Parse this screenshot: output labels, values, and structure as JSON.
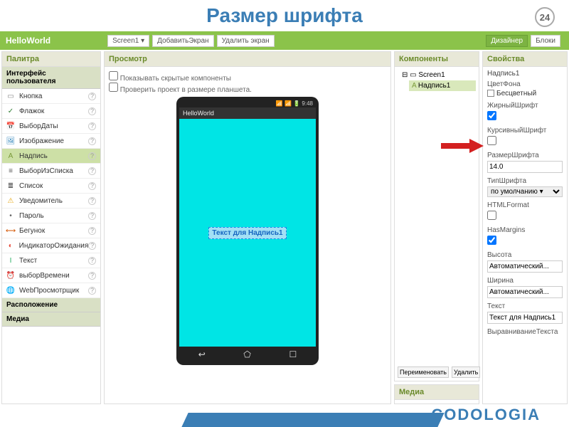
{
  "slide": {
    "title": "Размер шрифта",
    "number": "24"
  },
  "topbar": {
    "project": "HelloWorld",
    "screen_btn": "Screen1 ▾",
    "add_btn": "ДобавитьЭкран",
    "del_btn": "Удалить экран",
    "designer_btn": "Дизайнер",
    "blocks_btn": "Блоки"
  },
  "palette": {
    "title": "Палитра",
    "cat_ui": "Интерфейс пользователя",
    "items": [
      {
        "label": "Кнопка",
        "icon": "▭",
        "color": "#888"
      },
      {
        "label": "Флажок",
        "icon": "✓",
        "color": "#2e7d32"
      },
      {
        "label": "ВыборДаты",
        "icon": "📅",
        "color": "#c0392b"
      },
      {
        "label": "Изображение",
        "icon": "🖼",
        "color": "#2980b9"
      },
      {
        "label": "Надпись",
        "icon": "A",
        "color": "#7a9a3a",
        "sel": true
      },
      {
        "label": "ВыборИзСписка",
        "icon": "≡",
        "color": "#555"
      },
      {
        "label": "Список",
        "icon": "≣",
        "color": "#333"
      },
      {
        "label": "Уведомитель",
        "icon": "⚠",
        "color": "#e6a817"
      },
      {
        "label": "Пароль",
        "icon": "•",
        "color": "#666"
      },
      {
        "label": "Бегунок",
        "icon": "⟷",
        "color": "#d35400"
      },
      {
        "label": "ИндикаторОжидания",
        "icon": "◐",
        "color": "#e74c3c"
      },
      {
        "label": "Текст",
        "icon": "I",
        "color": "#27ae60"
      },
      {
        "label": "выборВремени",
        "icon": "⏰",
        "color": "#8e44ad"
      },
      {
        "label": "WebПросмотрщик",
        "icon": "🌐",
        "color": "#16a085"
      }
    ],
    "cat_layout": "Расположение",
    "cat_media": "Медиа"
  },
  "viewer": {
    "title": "Просмотр",
    "chk_hidden": "Показывать скрытые компоненты",
    "chk_tablet": "Проверить проект в размере планшета.",
    "phone_time": "9:48",
    "phone_app": "HelloWorld",
    "label_text": "Текст для Надпись1"
  },
  "components": {
    "title": "Компоненты",
    "root": "Screen1",
    "child": "Надпись1",
    "rename": "Переименовать",
    "delete": "Удалить",
    "media_title": "Медиа"
  },
  "props": {
    "title": "Свойства",
    "selected": "Надпись1",
    "bg_color_lbl": "ЦветФона",
    "bg_color_val": "Бесцветный",
    "bold_lbl": "ЖирныйШрифт",
    "bold_val": true,
    "italic_lbl": "КурсивныйШрифт",
    "italic_val": false,
    "fontsize_lbl": "РазмерШрифта",
    "fontsize_val": "14.0",
    "fonttype_lbl": "ТипШрифта",
    "fonttype_val": "по умолчанию ▾",
    "html_lbl": "HTMLFormat",
    "html_val": false,
    "margins_lbl": "HasMargins",
    "margins_val": true,
    "height_lbl": "Высота",
    "height_val": "Автоматический...",
    "width_lbl": "Ширина",
    "width_val": "Автоматический...",
    "text_lbl": "Текст",
    "text_val": "Текст для Надпись1",
    "align_lbl": "ВыравниваниеТекста"
  },
  "footer": {
    "logo": "CODOLOGIA"
  }
}
